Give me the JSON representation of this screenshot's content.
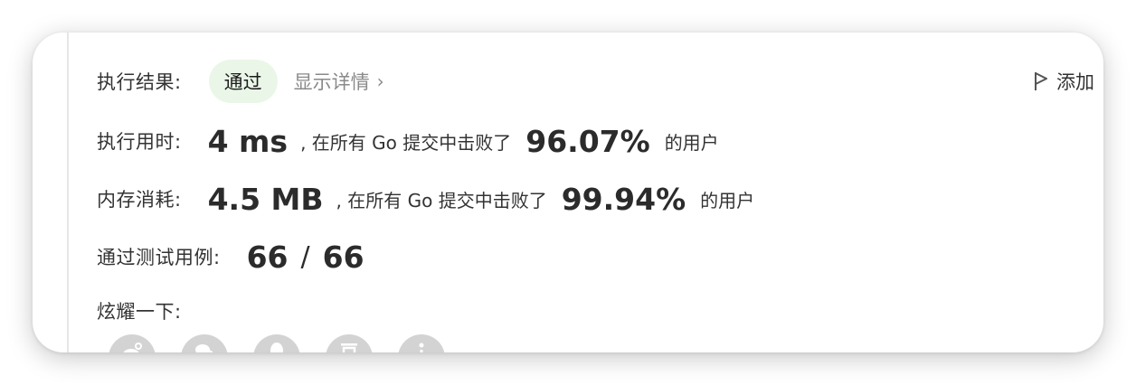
{
  "result": {
    "label": "执行结果:",
    "status": "通过",
    "detail_link": "显示详情",
    "detail_chevron": "›"
  },
  "add_note": {
    "label": "添加",
    "icon": "flag-icon"
  },
  "runtime": {
    "label": "执行用时:",
    "value": "4 ms",
    "beat_text": ", 在所有 Go 提交中击败了",
    "percent": "96.07%",
    "suffix": "的用户"
  },
  "memory": {
    "label": "内存消耗:",
    "value": "4.5 MB",
    "beat_text": ", 在所有 Go 提交中击败了",
    "percent": "99.94%",
    "suffix": "的用户"
  },
  "testcases": {
    "label": "通过测试用例:",
    "passed": "66",
    "separator": "/",
    "total": "66"
  },
  "share": {
    "label": "炫耀一下:",
    "icons": [
      "weibo-icon",
      "wechat-icon",
      "qq-icon",
      "douban-icon",
      "more-icon"
    ]
  },
  "colors": {
    "pass_badge_bg": "#eaf7e8",
    "share_icon_bg": "#d3d3d3"
  }
}
